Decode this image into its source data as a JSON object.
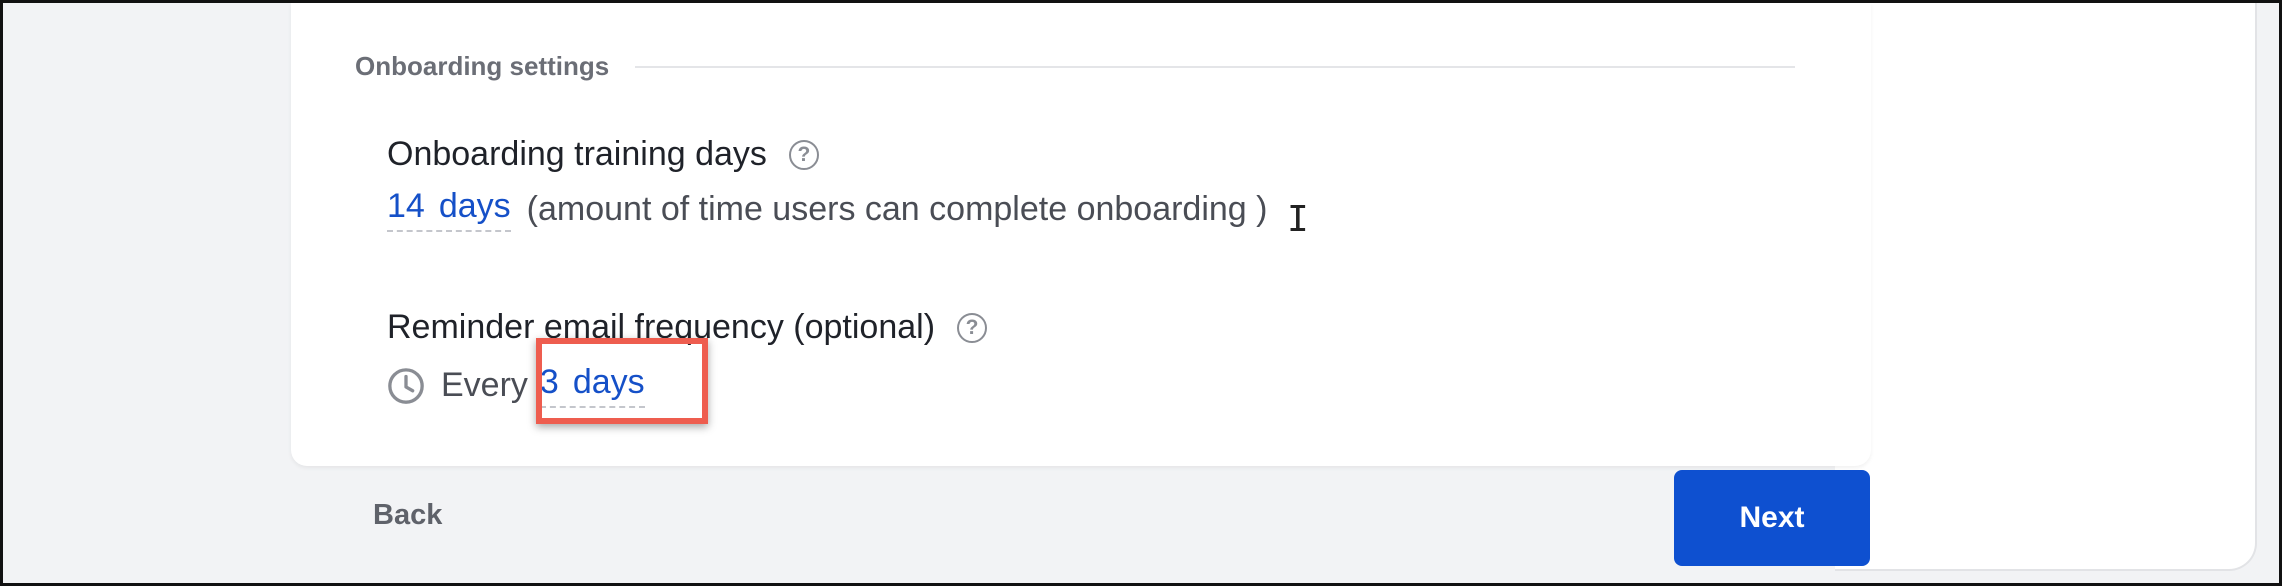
{
  "section": {
    "title": "Onboarding settings"
  },
  "training": {
    "label": "Onboarding training days",
    "help_icon": "question-circle-icon",
    "value_number": "14",
    "value_unit": "days",
    "description": "(amount of time users can complete onboarding )"
  },
  "reminder": {
    "label": "Reminder email frequency (optional)",
    "help_icon": "question-circle-icon",
    "icon": "clock-icon",
    "prefix": "Every",
    "value_number": "3",
    "value_unit": "days"
  },
  "footer": {
    "back_label": "Back",
    "next_label": "Next"
  },
  "colors": {
    "link": "#1550c8",
    "primary_button": "#0e50d0",
    "highlight": "#ee5d4f"
  }
}
